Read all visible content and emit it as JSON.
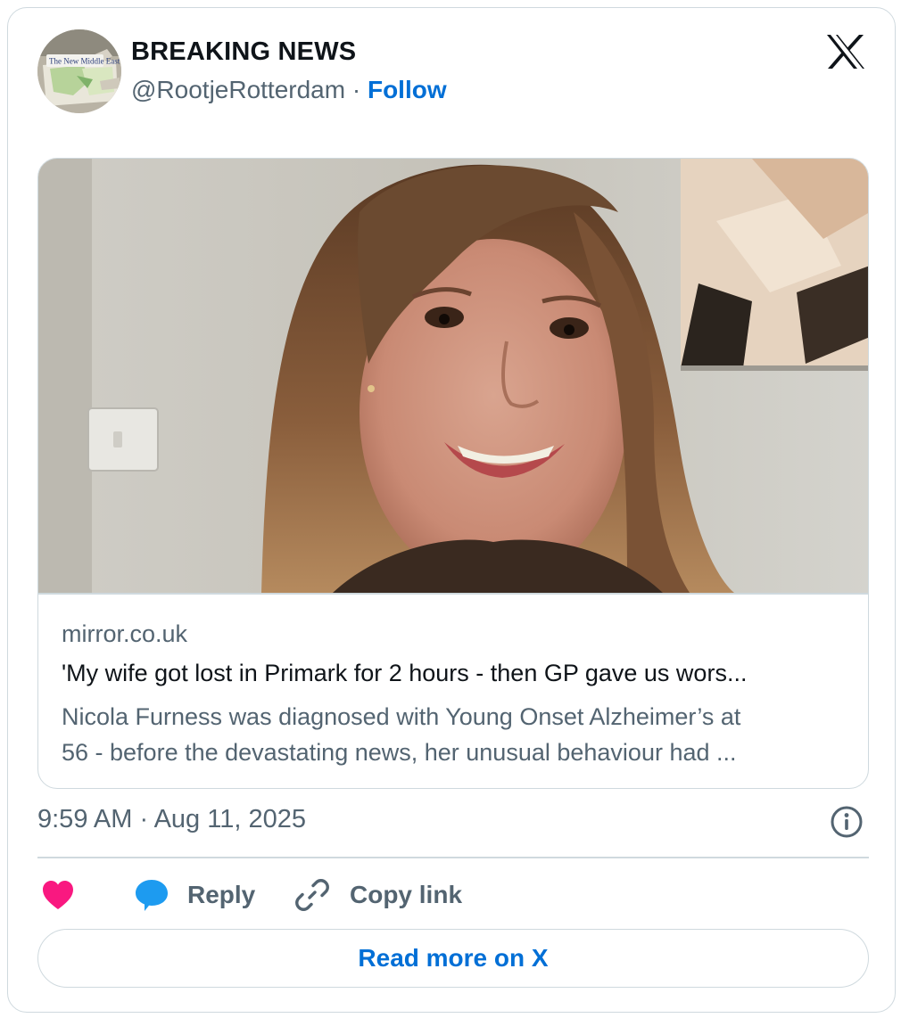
{
  "author": {
    "display_name": "BREAKING NEWS",
    "handle": "@RootjeRotterdam",
    "separator": "·",
    "follow_label": "Follow",
    "avatar_text": "The New Middle East"
  },
  "brand": {
    "logo_icon": "x-logo-icon"
  },
  "link_card": {
    "domain": "mirror.co.uk",
    "headline": "'My wife got lost in Primark for 2 hours - then GP gave us wors...",
    "description_lines": [
      "Nicola Furness was diagnosed with Young Onset Alzheimer’s at",
      "56 - before the devastating news, her unusual behaviour had ..."
    ]
  },
  "meta": {
    "timestamp": "9:59 AM · Aug 11, 2025",
    "info_icon": "info-icon"
  },
  "actions": {
    "like_icon": "heart-icon",
    "reply_label": "Reply",
    "reply_icon": "speech-bubble-icon",
    "copy_label": "Copy link",
    "copy_icon": "link-icon"
  },
  "read_more_label": "Read more on X",
  "colors": {
    "accent_blue": "#006fd6",
    "like_pink": "#f91880",
    "reply_blue": "#1d9bf0",
    "text_primary": "#0f1419",
    "text_secondary": "#536471",
    "border": "#cfd9de"
  }
}
